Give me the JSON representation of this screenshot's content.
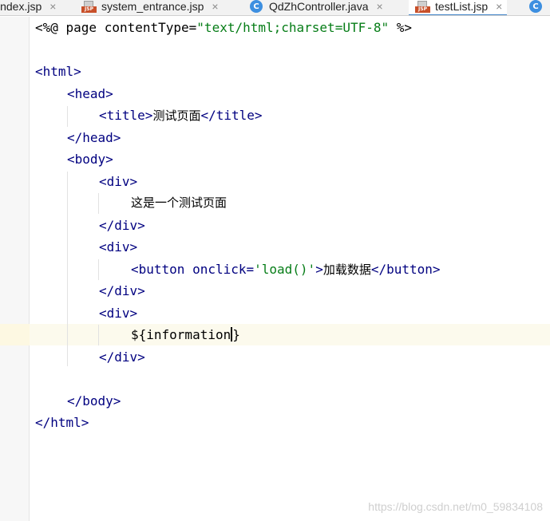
{
  "tabs": [
    {
      "label": "index.jsp",
      "icon": "jsp-file-icon",
      "active": false
    },
    {
      "label": "system_entrance.jsp",
      "icon": "jsp-file-icon",
      "active": false
    },
    {
      "label": "QdZhController.java",
      "icon": "java-class-icon",
      "active": false
    },
    {
      "label": "testList.jsp",
      "icon": "jsp-file-icon",
      "active": true
    },
    {
      "label": "",
      "icon": "java-class-icon",
      "active": false
    }
  ],
  "icons": {
    "jsp_badge": "JSP",
    "class_badge": "C",
    "close_glyph": "×"
  },
  "editor": {
    "lines": {
      "l1": {
        "directive_open": "<%@ page contentType=",
        "directive_value": "\"text/html;charset=UTF-8\"",
        "directive_close": " %>"
      },
      "l3": "<html>",
      "l4": "<head>",
      "l5": {
        "open": "<title>",
        "text": "测试页面",
        "close": "</title>"
      },
      "l6": "</head>",
      "l7": "<body>",
      "l8": "<div>",
      "l9": "这是一个测试页面",
      "l10": "</div>",
      "l11": "<div>",
      "l12": {
        "open": "<button onclick=",
        "attr": "'load()'",
        "gt": ">",
        "text": "加载数据",
        "close": "</button>"
      },
      "l13": "</div>",
      "l14": "<div>",
      "l15": {
        "before_caret": "${information",
        "after_caret": "}"
      },
      "l16": "</div>",
      "l18": "</body>",
      "l19": "</html>"
    }
  },
  "watermark": "https://blog.csdn.net/m0_59834108",
  "colors": {
    "tag": "#000080",
    "string": "#067d17",
    "active_tab_underline": "#4083c9",
    "caret_line": "#fcfaed",
    "jsp_icon": "#c8502a",
    "class_icon": "#3d8fe0"
  }
}
